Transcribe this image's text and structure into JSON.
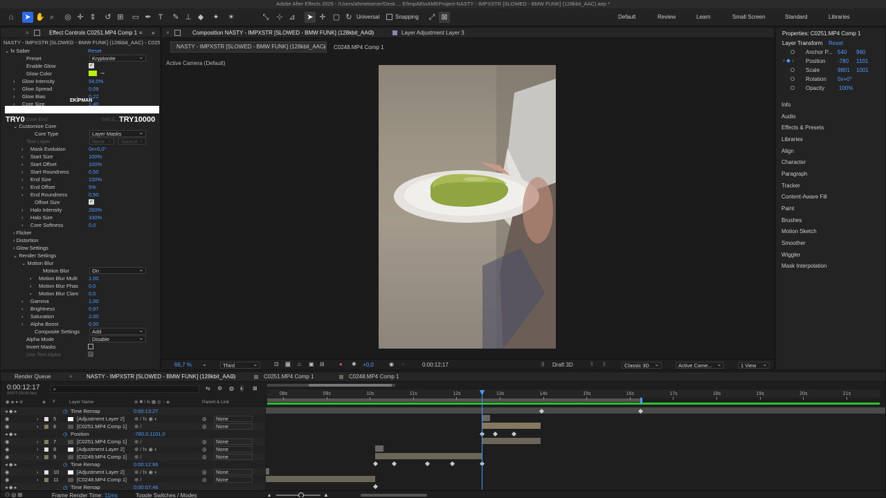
{
  "app": {
    "title": "Adobe After Effects 2025 - /Users/ahmetsener/Desk ... E/tmpAEtoAMEProject-NASTY - IMPXSTR [SLOWED - BMW FUNK] (128kbit_AAC).aep *"
  },
  "toolbar": {
    "universal_label": "Universal",
    "snapping_label": "Snapping",
    "workspaces": [
      "Default",
      "Review",
      "Learn",
      "Small Screen",
      "Standard",
      "Libraries"
    ]
  },
  "effect_controls": {
    "tab_label": "Effect Controls C0251.MP4 Comp 1",
    "layer_path": "NASTY - IMPXSTR [SLOWED - BMW FUNK] (128kbit_AAC) - C025",
    "effect_name": "Saber",
    "reset_label": "Reset",
    "preset": {
      "label": "Preset",
      "value": "Kryptonite"
    },
    "enable_glow": "Enable Glow",
    "glow_color": "Glow Color",
    "glow_intensity": {
      "label": "Glow Intensity",
      "value": "54,0%"
    },
    "glow_spread": {
      "label": "Glow Spread",
      "value": "0,09"
    },
    "glow_bias": {
      "label": "Glow Bias",
      "value": "0,22"
    },
    "core_size": {
      "label": "Core Size",
      "value": "1,40"
    },
    "core_end": {
      "label": "Core End",
      "value": "540,0,..."
    },
    "overlay": {
      "title": "EKİPMAN",
      "left": "TRY0",
      "right": "TRY10000"
    },
    "customize_core": "Customize Core",
    "core_type": {
      "label": "Core Type",
      "value": "Layer Masks"
    },
    "text_layer": {
      "label": "Text Layer",
      "value1": "None",
      "value2": "Source"
    },
    "mask_evolution": {
      "label": "Mask Evolution",
      "value": "0x+0,0°"
    },
    "start_size": {
      "label": "Start Size",
      "value": "100%"
    },
    "start_offset": {
      "label": "Start Offset",
      "value": "100%"
    },
    "start_roundness": {
      "label": "Start Roundness",
      "value": "0,50"
    },
    "end_size": {
      "label": "End Size",
      "value": "100%"
    },
    "end_offset": {
      "label": "End Offset",
      "value": "5%"
    },
    "end_roundness": {
      "label": "End Roundness",
      "value": "0,50"
    },
    "offset_size": "Offset Size",
    "halo_intensity": {
      "label": "Halo Intensity",
      "value": "260%"
    },
    "halo_size": {
      "label": "Halo Size",
      "value": "330%"
    },
    "core_softness": {
      "label": "Core Softness",
      "value": "0,0"
    },
    "flicker": "Flicker",
    "distortion": "Distortion",
    "glow_settings": "Glow Settings",
    "render_settings": "Render Settings",
    "motion_blur_group": "Motion Blur",
    "motion_blur": {
      "label": "Motion Blur",
      "value": "On"
    },
    "motion_blur_multi": {
      "label": "Motion Blur Multi",
      "value": "1,00"
    },
    "motion_blur_phase": {
      "label": "Motion Blur Phas",
      "value": "0,0"
    },
    "motion_blur_clamp": {
      "label": "Motion Blur Clam",
      "value": "0,0"
    },
    "gamma": {
      "label": "Gamma",
      "value": "1,00"
    },
    "brightness": {
      "label": "Brightness",
      "value": "0,97"
    },
    "saturation": {
      "label": "Saturation",
      "value": "2,00"
    },
    "alpha_boost": {
      "label": "Alpha Boost",
      "value": "0,00"
    },
    "composite_settings": {
      "label": "Composite Settings",
      "value": "Add"
    },
    "alpha_mode": {
      "label": "Alpha Mode",
      "value": "Disable"
    },
    "invert_masks": "Invert Masks",
    "use_text_alpha": "Use Text Alpha"
  },
  "composition": {
    "tab_label": "Composition NASTY - IMPXSTR [SLOWED - BMW FUNK] (128kbit_AAC)",
    "layer_tab": "Layer Adjustment Layer 3",
    "sub_tabs": [
      "NASTY - IMPXSTR [SLOWED - BMW FUNK] (128kbit_AAC)",
      "C0248.MP4 Comp 1"
    ],
    "camera_label": "Active Camera (Default)",
    "zoom": "66,7 %",
    "resolution": "Third",
    "exposure": "+0,0",
    "timecode": "0:00:12:17",
    "draft3d": "Draft 3D",
    "renderer": "Classic 3D",
    "camera_select": "Active Came...",
    "view": "1 View"
  },
  "properties": {
    "title": "Properties: C0251.MP4 Comp 1",
    "section": "Layer Transform",
    "reset_label": "Reset",
    "anchor": {
      "label": "Anchor P...",
      "x": "540",
      "y": "960"
    },
    "position": {
      "label": "Position",
      "x": "-780",
      "y": "1101"
    },
    "scale": {
      "label": "Scale",
      "x": "9801",
      "y": "1001"
    },
    "rotation": {
      "label": "Rotation",
      "value": "0x+0°"
    },
    "opacity": {
      "label": "Opacity",
      "value": "100%"
    },
    "panels": [
      "Info",
      "Audio",
      "Effects & Presets",
      "Libraries",
      "Align",
      "Character",
      "Paragraph",
      "Tracker",
      "Content-Aware Fill",
      "Paint",
      "Brushes",
      "Motion Sketch",
      "Smoother",
      "Wiggler",
      "Mask Interpolation"
    ]
  },
  "timeline": {
    "tabs": [
      "Render Queue",
      "NASTY - IMPXSTR [SLOWED - BMW FUNK] (128kbit_AAC)",
      "C0251.MP4 Comp 1",
      "C0248.MP4 Comp 1"
    ],
    "current_time": "0:00:12:17",
    "frames_info": "00377 (30.00 fps)",
    "search_placeholder": "",
    "col_layer_name": "Layer Name",
    "col_parent": "Parent & Link",
    "ticks": [
      "08s",
      "09s",
      "10s",
      "11s",
      "12s",
      "13s",
      "14s",
      "15s",
      "16s",
      "17s",
      "18s",
      "19s",
      "20s",
      "21s"
    ],
    "rows": [
      {
        "num": "",
        "name": "Time Remap",
        "value": "0:00:13:27",
        "parent": ""
      },
      {
        "num": "5",
        "name": "[Adjustment Layer 2]",
        "value": "",
        "parent": "None"
      },
      {
        "num": "6",
        "name": "[C0251.MP4 Comp 1]",
        "value": "",
        "parent": "None"
      },
      {
        "num": "",
        "name": "Position",
        "value": "-780,0,1101,0",
        "parent": ""
      },
      {
        "num": "7",
        "name": "[C0251.MP4 Comp 1]",
        "value": "",
        "parent": "None"
      },
      {
        "num": "8",
        "name": "[Adjustment Layer 2]",
        "value": "",
        "parent": "None"
      },
      {
        "num": "9",
        "name": "[C0249.MP4 Comp 1]",
        "value": "",
        "parent": "None"
      },
      {
        "num": "",
        "name": "Time Remap",
        "value": "0:00:12:66",
        "parent": ""
      },
      {
        "num": "10",
        "name": "[Adjustment Layer 2]",
        "value": "",
        "parent": "None"
      },
      {
        "num": "11",
        "name": "[C0248.MP4 Comp 1]",
        "value": "",
        "parent": "None"
      },
      {
        "num": "",
        "name": "Time Remap",
        "value": "0:00:07:46",
        "parent": ""
      }
    ],
    "frame_render_label": "Frame Render Time:",
    "frame_render_value": "11ms",
    "toggle_label": "Toggle Switches / Modes"
  },
  "colors": {
    "accent": "#2d6ae0",
    "glow_color": "#b6f01a",
    "work_area": "#2fbf2f",
    "playhead": "#4d9bff"
  }
}
